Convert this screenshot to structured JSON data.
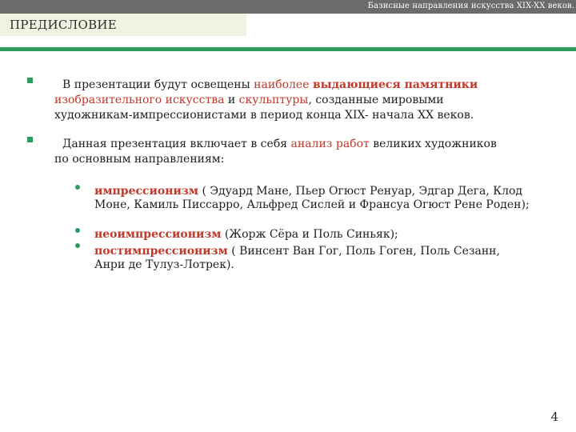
{
  "header": {
    "presentation_title": "Базисные направления искусства XIX-XX веков."
  },
  "slide": {
    "title": "ПРЕДИСЛОВИЕ",
    "page_number": "4"
  },
  "colors": {
    "accent": "#2f9a5d",
    "highlight": "#c0392b",
    "top_bar": "#6b6b6b",
    "title_background": "#f2f2e2"
  },
  "bullet1": {
    "part1": "В презентации будут освещены ",
    "part2": "наиболее ",
    "part3": "выдающиеся памятники",
    "part4": "изобразительного искусства",
    "part5": " и ",
    "part6": "скульптуры",
    "part7": ", созданные мировыми",
    "part8": "художникам-импрессионистами в период конца XIX- начала XX веков."
  },
  "bullet2": {
    "part1": "Данная презентация включает в себя ",
    "part2": "анализ работ",
    "part3": " великих художников",
    "part4": "по основным направлениям:"
  },
  "subitems": [
    {
      "term": "импрессионизм",
      "text": " ( Эдуард Мане, Пьер Огюст Ренуар, Эдгар Дега, Клод Моне, Камиль Писсарро, Альфред Сислей и Франсуа Огюст Рене Роден);"
    },
    {
      "term": "неоимпрессионизм",
      "text": " (Жорж Сёра и Поль Синьяк);"
    },
    {
      "term": "постимпрессионизм",
      "text": " ( Винсент Ван Гог, Поль Гоген, Поль Сезанн, Анри де Тулуз-Лотрек)."
    }
  ]
}
